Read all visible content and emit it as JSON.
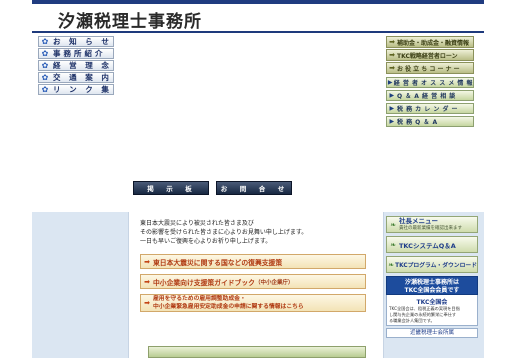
{
  "header": {
    "title": "汐瀬税理士事務所"
  },
  "left_nav": {
    "items": [
      {
        "label": "お 知 ら せ",
        "icon": "flower-icon"
      },
      {
        "label": "事務所紹介",
        "icon": "flower-icon"
      },
      {
        "label": "経 営 理 念",
        "icon": "flower-icon"
      },
      {
        "label": "交 通 案 内",
        "icon": "flower-icon"
      },
      {
        "label": "リ ン ク 集",
        "icon": "flower-icon"
      }
    ]
  },
  "right_nav": {
    "olive_items": [
      {
        "label": "補助金・助成金・融資情報",
        "icon": "arrow-right-icon"
      },
      {
        "label": "TKC戦略経営者ローン",
        "icon": "arrow-right-icon"
      },
      {
        "label": "お 役 立 ち コ ー ナ ー",
        "icon": "arrow-right-icon"
      }
    ],
    "green_items": [
      {
        "label": "経 営 者 オ ス ス メ 情 報",
        "icon": "triangle-right-icon"
      },
      {
        "label": "Q ＆ A 経 営 相 談",
        "icon": "triangle-right-icon"
      },
      {
        "label": "税 務 カ レ ン ダ ー",
        "icon": "triangle-right-icon"
      },
      {
        "label": "税 務 Q ＆ A",
        "icon": "triangle-right-icon"
      }
    ]
  },
  "bulletin": {
    "board_label": "掲　示　板",
    "contact_label": "お　問　合　せ"
  },
  "message": {
    "lines": [
      "東日本大震災により被災された皆さま及び",
      "その影響を受けられた皆さまに心よりお見舞い申し上げます。",
      "一日も早いご復興を心よりお祈り申し上げます。"
    ],
    "banners": [
      {
        "label": "東日本大震災に関する国などの復興支援策",
        "icon": "arrow-right-icon"
      },
      {
        "label": "中小企業向け支援策ガイドブック",
        "note": "（中小企業庁）",
        "icon": "arrow-right-icon"
      }
    ],
    "tall_banner": {
      "line1": "雇用を守るための雇用調整助成金・",
      "line2": "中小企業緊急雇用安定助成金の申請に関する情報はこちら",
      "icon": "arrow-right-icon"
    }
  },
  "lower_right": {
    "buttons": [
      {
        "label": "社長メニュー",
        "sub": "貴社の最新業績を確認出来ます",
        "icon": "leaf-icon"
      },
      {
        "label": "TKCシステムQ＆A",
        "icon": "leaf-icon"
      },
      {
        "label": "TKCプログラム・ダウンロード",
        "icon": "leaf-icon"
      }
    ],
    "tkc": {
      "line1": "汐瀬税理士事務所は",
      "line2": "TKC全国会会員です",
      "logo": "TKC全国会",
      "note1": "TKC全国会は、租税正義の実現を目指",
      "note2": "し関与先企業の永続的繁栄に奉仕す",
      "note3": "る職業会計人集団です。",
      "link": "近畿税理士会所属"
    }
  },
  "colors": {
    "header_stripe": "#203c80",
    "lower_background": "#dbe6f2",
    "banner_text": "#b03a12",
    "tkc_blue": "#1d4c9d"
  }
}
